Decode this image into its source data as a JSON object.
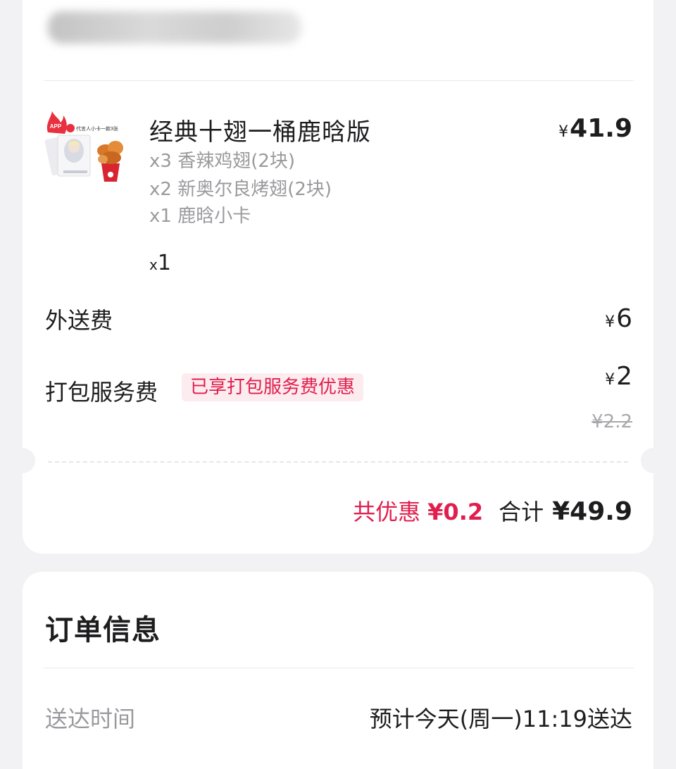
{
  "order": {
    "product": {
      "title": "经典十翅一桶鹿晗版",
      "price_symbol": "¥",
      "price": "41.9",
      "specs": [
        "x3 香辣鸡翅(2块)",
        "x2 新奥尔良烤翅(2块)",
        "x1 鹿晗小卡"
      ],
      "qty_prefix": "x",
      "qty": "1",
      "image_icon": "product-thumbnail",
      "image_badge_text": "APP",
      "image_caption": "代言人小卡一款3张"
    },
    "delivery_fee": {
      "label": "外送费",
      "symbol": "¥",
      "value": "6"
    },
    "packing_fee": {
      "label": "打包服务费",
      "badge": "已享打包服务费优惠",
      "symbol": "¥",
      "value": "2",
      "original": "¥2.2"
    },
    "summary": {
      "discount_label": "共优惠",
      "discount_value": "¥0.2",
      "total_label": "合计",
      "total_value": "¥49.9"
    }
  },
  "order_info": {
    "title": "订单信息",
    "rows": [
      {
        "label": "送达时间",
        "value": "预计今天(周一)11:19送达"
      }
    ]
  },
  "colors": {
    "accent": "#e01f4e",
    "badge_bg": "#fdecef",
    "page_bg": "#f2f2f4",
    "muted_text": "#9a9a9e"
  }
}
